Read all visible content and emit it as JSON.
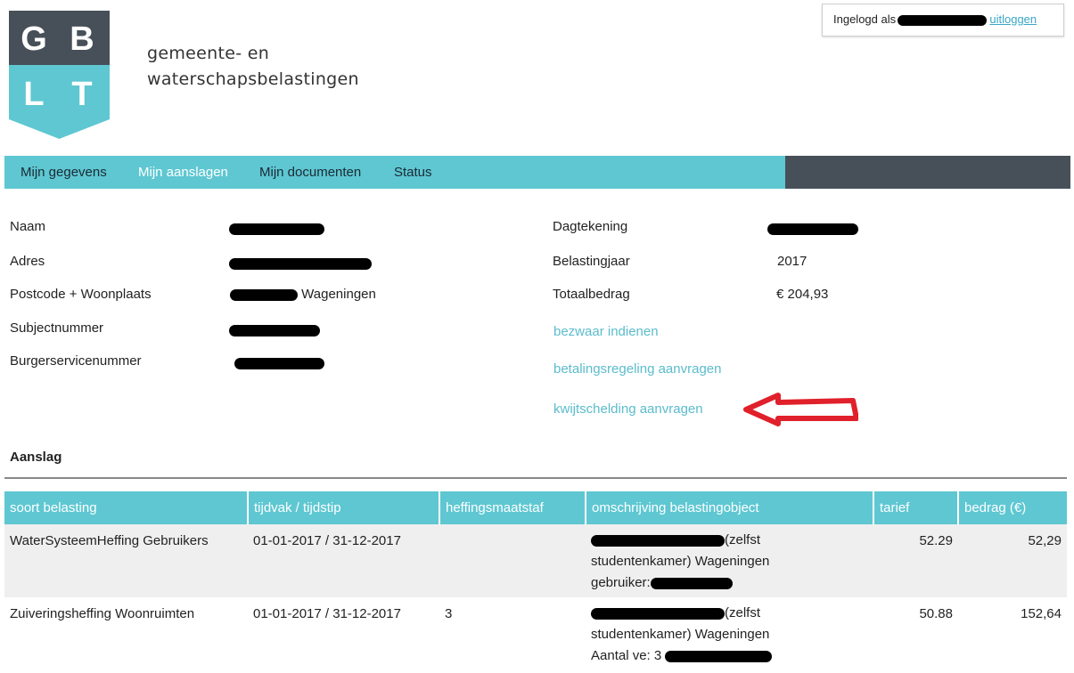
{
  "logo": {
    "letters": [
      "G",
      "B",
      "L",
      "T"
    ],
    "colors": {
      "top": "#475059",
      "bottom": "#5ec7d2"
    }
  },
  "brand": {
    "line1": "gemeente- en",
    "line2": "waterschapsbelastingen"
  },
  "login": {
    "prefix": "Ingelogd als",
    "logout": "uitloggen"
  },
  "nav": {
    "items": [
      {
        "label": "Mijn gegevens"
      },
      {
        "label": "Mijn aanslagen"
      },
      {
        "label": "Mijn documenten"
      },
      {
        "label": "Status"
      }
    ],
    "active": "Mijn aanslagen"
  },
  "info": {
    "naam": "Naam",
    "adres": "Adres",
    "postcode": "Postcode + Woonplaats",
    "postcode_value": "Wageningen",
    "subject": "Subjectnummer",
    "bsn": "Burgerservicenummer",
    "dagtekening": "Dagtekening",
    "belastingjaar": "Belastingjaar",
    "belastingjaar_value": "2017",
    "totaal": "Totaalbedrag",
    "totaal_value": "€ 204,93"
  },
  "links": {
    "bezwaar": "bezwaar indienen",
    "betaling": "betalingsregeling aanvragen",
    "kwijtschelding": "kwijtschelding aanvragen"
  },
  "section_title": "Aanslag",
  "table": {
    "headers": [
      "soort belasting",
      "tijdvak / tijdstip",
      "heffingsmaatstaf",
      "omschrijving belastingobject",
      "tarief",
      "bedrag (€)"
    ],
    "rows": [
      {
        "soort": "WaterSysteemHeffing Gebruikers",
        "tijdvak": "01-01-2017 / 31-12-2017",
        "maatstaf": "",
        "obj_l1": "(zelfst",
        "obj_l2": "studentenkamer) Wageningen",
        "obj_l3": "gebruiker:",
        "tarief": "52.29",
        "bedrag": "52,29"
      },
      {
        "soort": "Zuiveringsheffing Woonruimten",
        "tijdvak": "01-01-2017 / 31-12-2017",
        "maatstaf": "3",
        "obj_l1": "(zelfst",
        "obj_l2": "studentenkamer) Wageningen",
        "obj_l3": "Aantal ve: 3",
        "tarief": "50.88",
        "bedrag": "152,64"
      }
    ]
  },
  "colors": {
    "accent": "#5ec7d2",
    "dark": "#475059",
    "link": "#5bbccc",
    "arrow": "#e0202a"
  }
}
